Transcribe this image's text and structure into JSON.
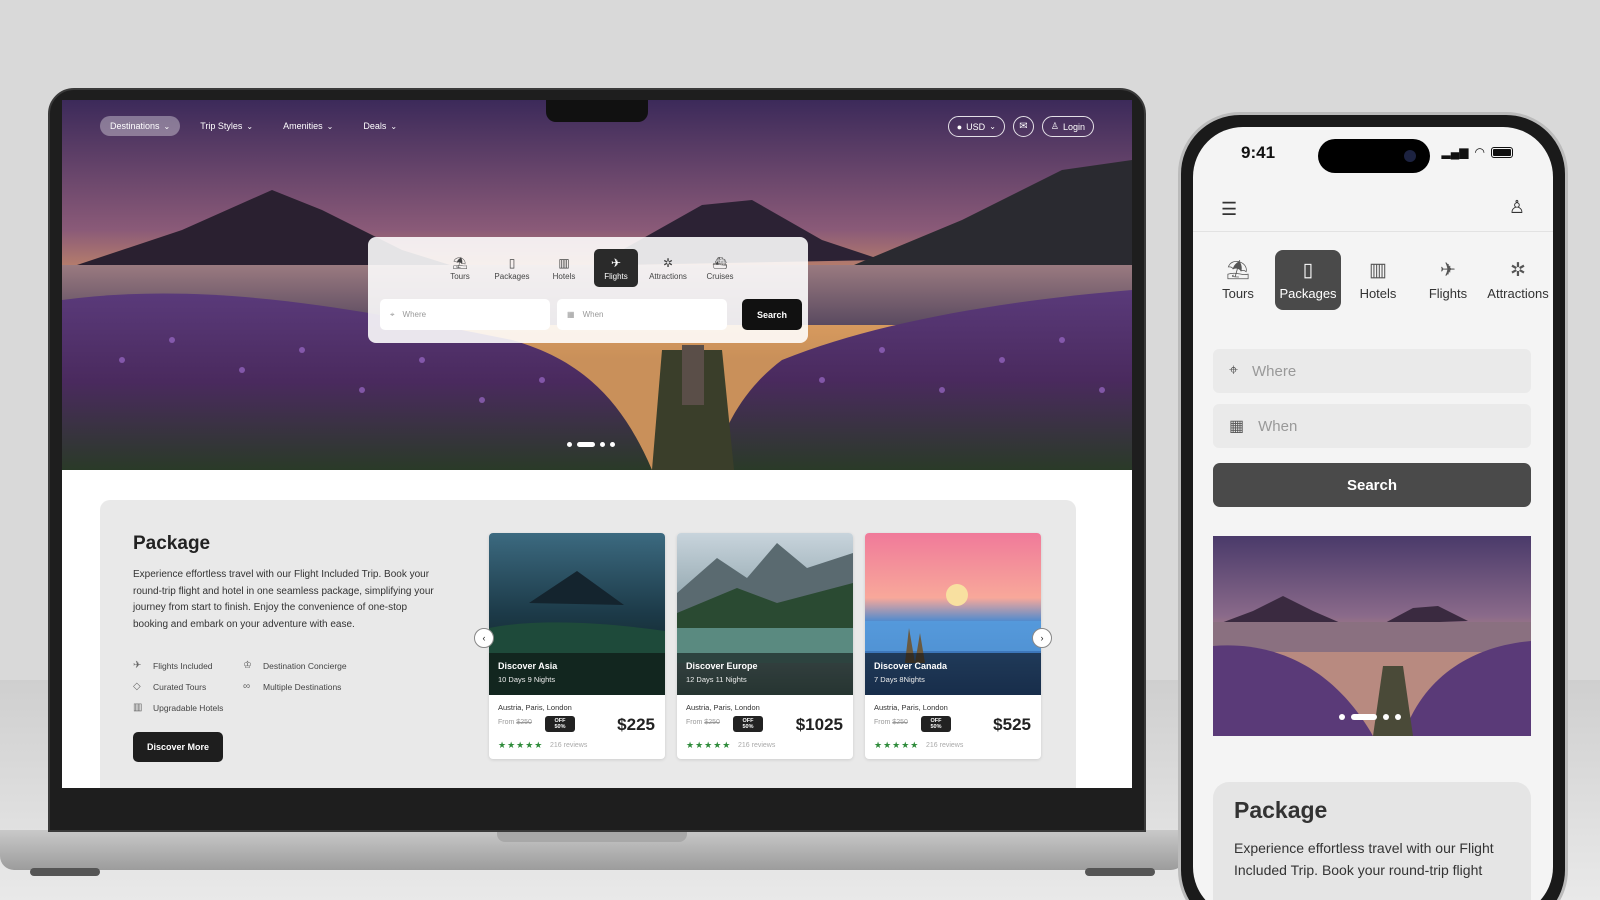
{
  "laptop": {
    "nav": {
      "items": [
        {
          "label": "Destinations"
        },
        {
          "label": "Trip Styles"
        },
        {
          "label": "Amenities"
        },
        {
          "label": "Deals"
        }
      ],
      "currency": "USD",
      "login": "Login"
    },
    "search_card": {
      "tabs": [
        {
          "label": "Tours",
          "icon": "palm-tree-icon"
        },
        {
          "label": "Packages",
          "icon": "luggage-icon"
        },
        {
          "label": "Hotels",
          "icon": "hotel-icon"
        },
        {
          "label": "Flights",
          "icon": "plane-icon",
          "active": true
        },
        {
          "label": "Attractions",
          "icon": "ferris-wheel-icon"
        },
        {
          "label": "Cruises",
          "icon": "ship-icon"
        }
      ],
      "where_placeholder": "Where",
      "when_placeholder": "When",
      "search_label": "Search"
    },
    "package": {
      "title": "Package",
      "description": "Experience effortless travel with our Flight Included Trip. Book your round-trip flight and hotel in one seamless package, simplifying your journey from start to finish. Enjoy the convenience of one-stop booking and embark on your adventure with ease.",
      "features": [
        {
          "label": "Flights Included",
          "icon": "plane-icon"
        },
        {
          "label": "Destination Concierge",
          "icon": "concierge-icon"
        },
        {
          "label": "Curated Tours",
          "icon": "tag-icon"
        },
        {
          "label": "Multiple Destinations",
          "icon": "route-icon"
        },
        {
          "label": "Upgradable Hotels",
          "icon": "hotel-icon"
        }
      ],
      "cta": "Discover More",
      "cards": [
        {
          "name": "Discover Asia",
          "duration": "10 Days  9 Nights",
          "location": "Austria, Paris, London",
          "from_label": "From",
          "old_price": "$250",
          "badge_top": "OFF",
          "badge_bottom": "50%",
          "price": "$225",
          "stars": "★★★★★",
          "reviews": "216 reviews"
        },
        {
          "name": "Discover  Europe",
          "duration": "12 Days  11 Nights",
          "location": "Austria, Paris, London",
          "from_label": "From",
          "old_price": "$250",
          "badge_top": "OFF",
          "badge_bottom": "50%",
          "price": "$1025",
          "stars": "★★★★★",
          "reviews": "216 reviews"
        },
        {
          "name": "Discover  Canada",
          "duration": "7 Days  8Nights",
          "location": "Austria, Paris, London",
          "from_label": "From",
          "old_price": "$250",
          "badge_top": "OFF",
          "badge_bottom": "50%",
          "price": "$525",
          "stars": "★★★★★",
          "reviews": "216 reviews"
        }
      ]
    }
  },
  "phone": {
    "time": "9:41",
    "tabs": [
      {
        "label": "Tours",
        "icon": "palm-tree-icon"
      },
      {
        "label": "Packages",
        "icon": "luggage-icon",
        "active": true
      },
      {
        "label": "Hotels",
        "icon": "hotel-icon"
      },
      {
        "label": "Flights",
        "icon": "plane-icon"
      },
      {
        "label": "Attractions",
        "icon": "ferris-wheel-icon"
      }
    ],
    "where_placeholder": "Where",
    "when_placeholder": "When",
    "search_label": "Search",
    "package": {
      "title": "Package",
      "description": "Experience effortless travel with our Flight Included Trip. Book your round-trip flight"
    }
  },
  "colors": {
    "active_tab_dark": "#2a2a2a",
    "phone_button": "#4a4a4a",
    "star_green": "#2e8b3a"
  }
}
